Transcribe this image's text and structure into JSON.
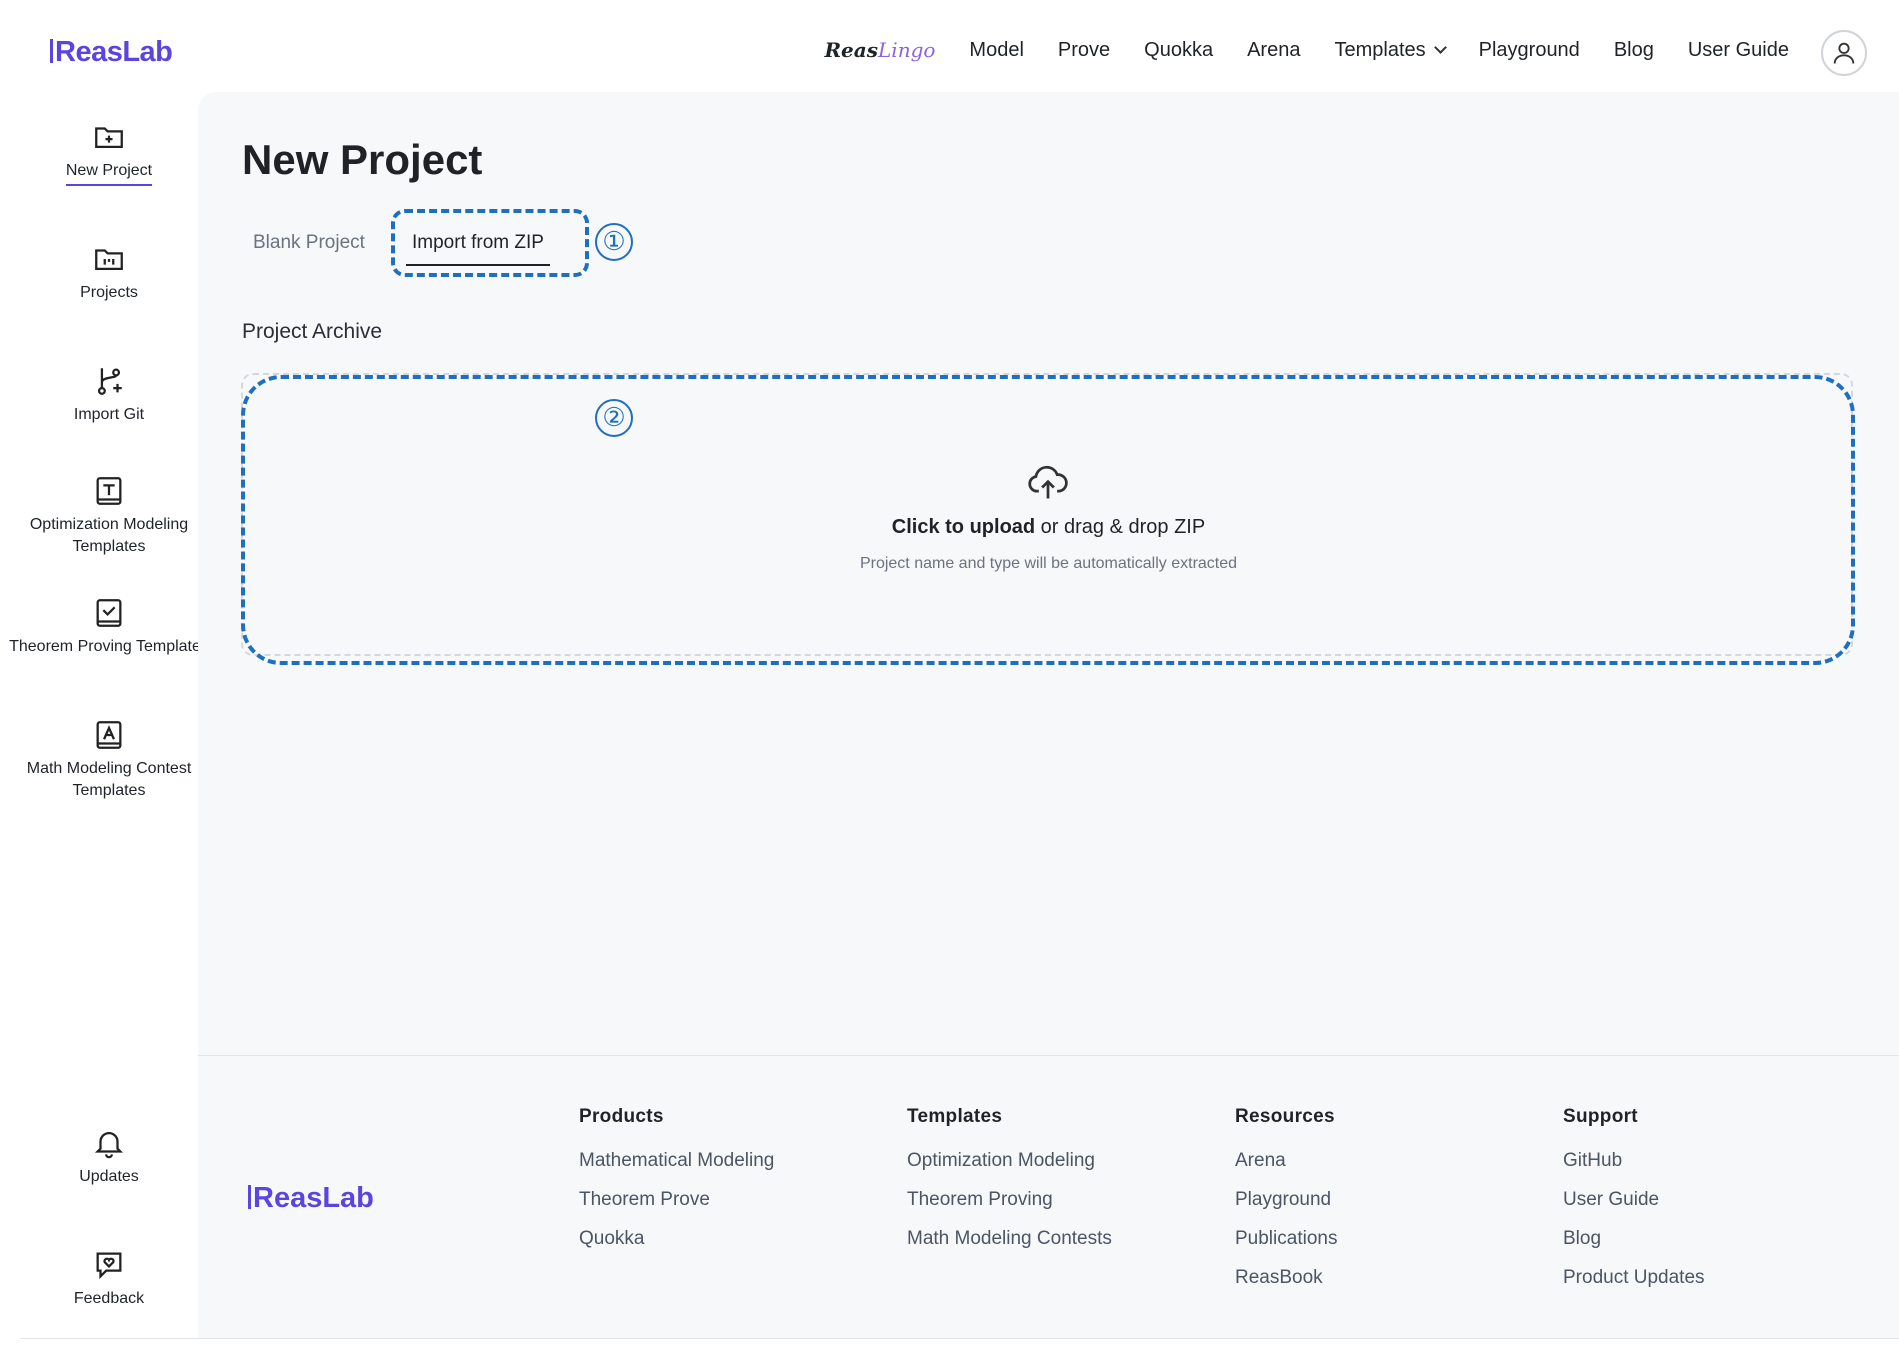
{
  "header": {
    "logo": "ReasLab",
    "brand_part1": "Reas",
    "brand_part2": "Lingo",
    "nav": [
      "Model",
      "Prove",
      "Quokka",
      "Arena",
      "Templates",
      "Playground",
      "Blog",
      "User Guide"
    ]
  },
  "sidebar": {
    "items": [
      {
        "label": "New Project",
        "icon": "folder-plus-icon"
      },
      {
        "label": "Projects",
        "icon": "folder-icon"
      },
      {
        "label": "Import Git",
        "icon": "git-branch-icon"
      },
      {
        "label": "Optimization Modeling Templates",
        "icon": "template-text-icon"
      },
      {
        "label": "Theorem Proving Templates",
        "icon": "template-check-icon"
      },
      {
        "label": "Math Modeling Contest Templates",
        "icon": "template-a-icon"
      }
    ],
    "bottom_items": [
      {
        "label": "Updates",
        "icon": "bell-icon"
      },
      {
        "label": "Feedback",
        "icon": "feedback-icon"
      }
    ]
  },
  "main": {
    "title": "New Project",
    "tabs": [
      "Blank Project",
      "Import from ZIP"
    ],
    "annotations": [
      "①",
      "②"
    ],
    "section_label": "Project Archive",
    "upload": {
      "strong": "Click to upload",
      "rest": " or drag & drop ZIP",
      "hint": "Project name and type will be automatically extracted"
    }
  },
  "footer": {
    "logo": "ReasLab",
    "columns": [
      {
        "title": "Products",
        "links": [
          "Mathematical Modeling",
          "Theorem Prove",
          "Quokka"
        ]
      },
      {
        "title": "Templates",
        "links": [
          "Optimization Modeling",
          "Theorem Proving",
          "Math Modeling Contests"
        ]
      },
      {
        "title": "Resources",
        "links": [
          "Arena",
          "Playground",
          "Publications",
          "ReasBook"
        ]
      },
      {
        "title": "Support",
        "links": [
          "GitHub",
          "User Guide",
          "Blog",
          "Product Updates"
        ]
      }
    ]
  },
  "colors": {
    "brand": "#5b45e0",
    "annotation": "#1f6fc1"
  }
}
